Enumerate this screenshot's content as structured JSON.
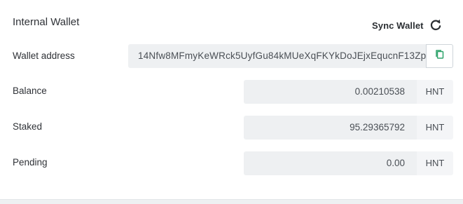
{
  "wallet": {
    "title": "Internal Wallet",
    "sync_label": "Sync Wallet",
    "sync_icon": "refresh-icon",
    "address_label": "Wallet address",
    "address_value": "14Nfw8MFmyKeWRck5UyfGu84kMUeXqFKYkDoJEjxEqucnF13Zp",
    "copy_icon": "copy-icon",
    "accent_color": "#2ea36b"
  },
  "balances": [
    {
      "label": "Balance",
      "value": "0.00210538",
      "unit": "HNT"
    },
    {
      "label": "Staked",
      "value": "95.29365792",
      "unit": "HNT"
    },
    {
      "label": "Pending",
      "value": "0.00",
      "unit": "HNT"
    }
  ]
}
